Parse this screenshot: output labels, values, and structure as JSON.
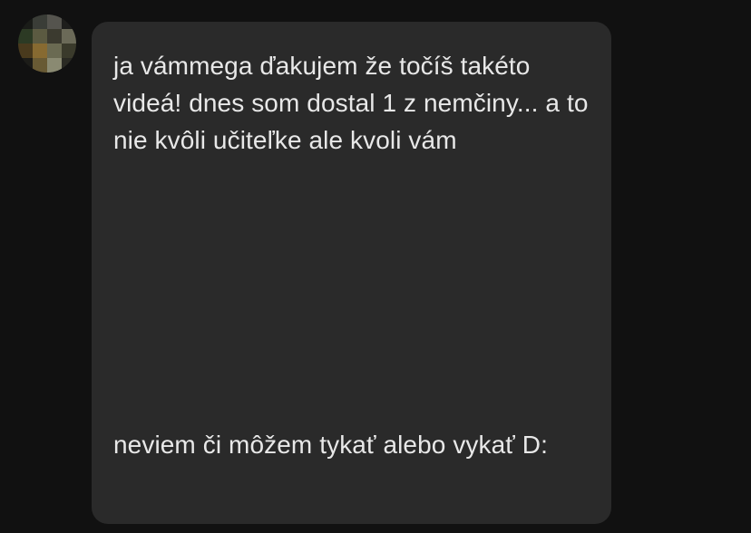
{
  "avatar": {
    "pixels": [
      "#1a1c18",
      "#3a3d36",
      "#55544d",
      "#1e1e1c",
      "#2b3a22",
      "#5b5a3e",
      "#3b3a2e",
      "#6b6a56",
      "#4a3a1a",
      "#8a6a2a",
      "#6a6a50",
      "#3a3a2a",
      "#1c1c18",
      "#6a5a30",
      "#8a8a70",
      "#2a2a22"
    ]
  },
  "comment": {
    "paragraph_1": "ja vámmega ďakujem že točíš takéto videá! dnes som dostal 1 z nemčiny... a to nie kvôli učiteľke ale kvoli vám",
    "paragraph_2": "neviem či môžem tykať alebo vykať D:"
  },
  "colors": {
    "background": "#111111",
    "bubble": "#2a2a2a",
    "text": "#e8e8e8"
  }
}
